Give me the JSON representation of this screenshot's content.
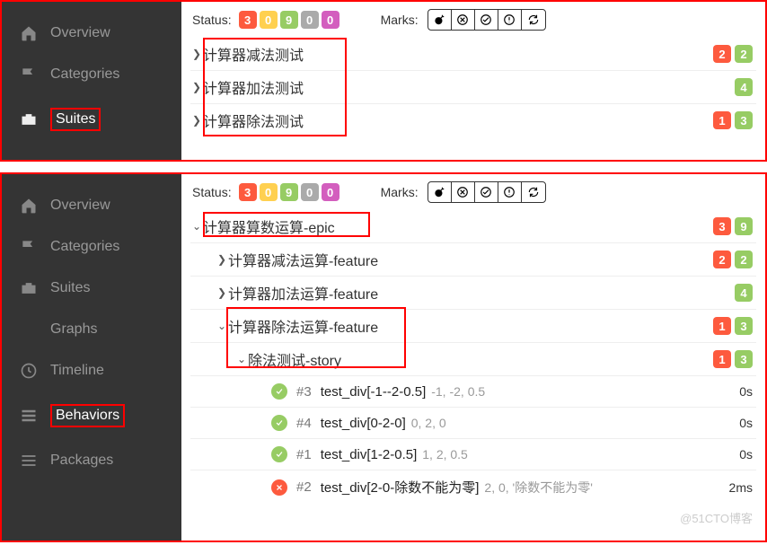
{
  "sidebar_top": {
    "items": [
      {
        "icon": "home",
        "label": "Overview",
        "active": false,
        "hl": false
      },
      {
        "icon": "flag",
        "label": "Categories",
        "active": false,
        "hl": false
      },
      {
        "icon": "briefcase",
        "label": "Suites",
        "active": true,
        "hl": true
      }
    ]
  },
  "sidebar_bottom": {
    "items": [
      {
        "icon": "home",
        "label": "Overview",
        "active": false,
        "hl": false
      },
      {
        "icon": "flag",
        "label": "Categories",
        "active": false,
        "hl": false
      },
      {
        "icon": "briefcase",
        "label": "Suites",
        "active": false,
        "hl": false
      },
      {
        "icon": "graph",
        "label": "Graphs",
        "active": false,
        "hl": false
      },
      {
        "icon": "clock",
        "label": "Timeline",
        "active": false,
        "hl": false
      },
      {
        "icon": "list",
        "label": "Behaviors",
        "active": true,
        "hl": true
      },
      {
        "icon": "bars",
        "label": "Packages",
        "active": false,
        "hl": false
      }
    ]
  },
  "toolbar": {
    "status_label": "Status:",
    "marks_label": "Marks:",
    "badges": [
      {
        "cls": "b-red",
        "val": "3"
      },
      {
        "cls": "b-yellow",
        "val": "0"
      },
      {
        "cls": "b-green",
        "val": "9"
      },
      {
        "cls": "b-gray",
        "val": "0"
      },
      {
        "cls": "b-purple",
        "val": "0"
      }
    ],
    "marks": [
      "bomb",
      "x",
      "check",
      "alert",
      "refresh"
    ]
  },
  "suites_tree": [
    {
      "title": "计算器减法测试",
      "counts": [
        {
          "cls": "b-red",
          "val": "2"
        },
        {
          "cls": "b-green",
          "val": "2"
        }
      ]
    },
    {
      "title": "计算器加法测试",
      "counts": [
        {
          "cls": "b-green",
          "val": "4"
        }
      ]
    },
    {
      "title": "计算器除法测试",
      "counts": [
        {
          "cls": "b-red",
          "val": "1"
        },
        {
          "cls": "b-green",
          "val": "3"
        }
      ]
    }
  ],
  "behaviors_tree": {
    "epic": {
      "title": "计算器算数运算-epic",
      "counts": [
        {
          "cls": "b-red",
          "val": "3"
        },
        {
          "cls": "b-green",
          "val": "9"
        }
      ]
    },
    "features": [
      {
        "title": "计算器减法运算-feature",
        "expanded": false,
        "counts": [
          {
            "cls": "b-red",
            "val": "2"
          },
          {
            "cls": "b-green",
            "val": "2"
          }
        ]
      },
      {
        "title": "计算器加法运算-feature",
        "expanded": false,
        "counts": [
          {
            "cls": "b-green",
            "val": "4"
          }
        ]
      },
      {
        "title": "计算器除法运算-feature",
        "expanded": true,
        "counts": [
          {
            "cls": "b-red",
            "val": "1"
          },
          {
            "cls": "b-green",
            "val": "3"
          }
        ],
        "story": {
          "title": "除法测试-story",
          "counts": [
            {
              "cls": "b-red",
              "val": "1"
            },
            {
              "cls": "b-green",
              "val": "3"
            }
          ],
          "tests": [
            {
              "status": "pass",
              "num": "#3",
              "name": "test_div[-1--2-0.5]",
              "params": "-1, -2, 0.5",
              "dur": "0s"
            },
            {
              "status": "pass",
              "num": "#4",
              "name": "test_div[0-2-0]",
              "params": "0, 2, 0",
              "dur": "0s"
            },
            {
              "status": "pass",
              "num": "#1",
              "name": "test_div[1-2-0.5]",
              "params": "1, 2, 0.5",
              "dur": "0s"
            },
            {
              "status": "fail",
              "num": "#2",
              "name": "test_div[2-0-除数不能为零]",
              "params": "2, 0, '除数不能为零'",
              "dur": "2ms"
            }
          ]
        }
      }
    ]
  },
  "watermark": "@51CTO博客"
}
